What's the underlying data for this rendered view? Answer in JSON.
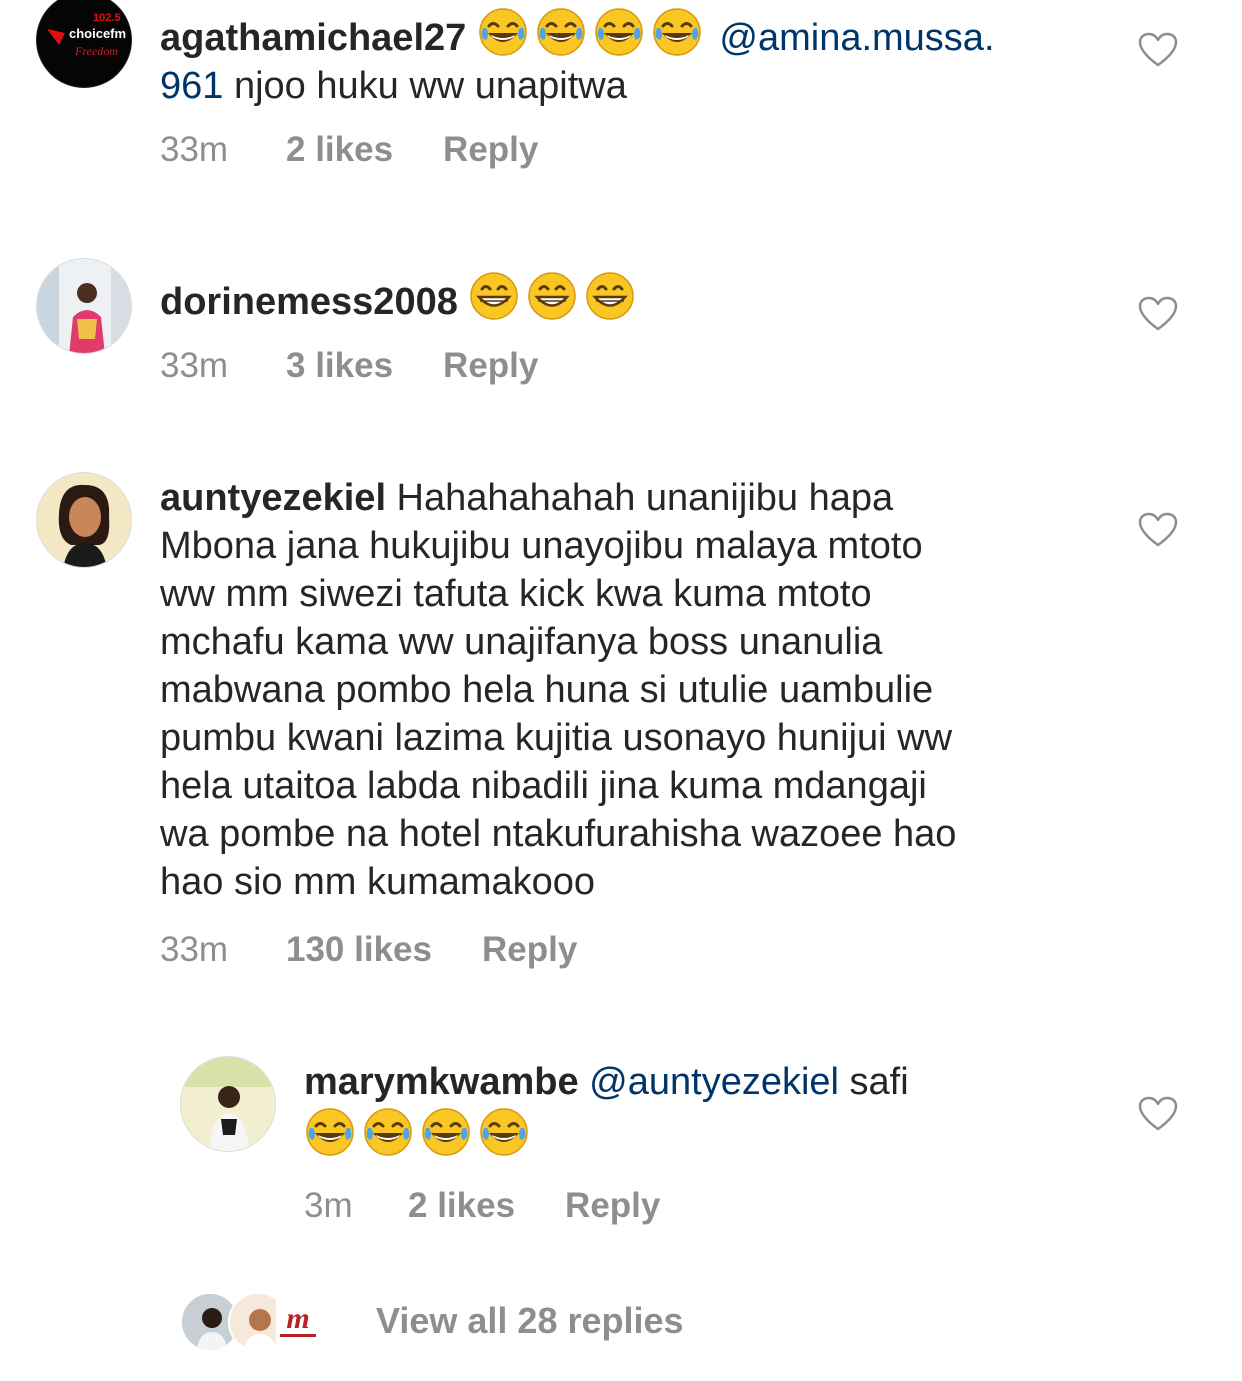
{
  "comments": [
    {
      "username": "agathamichael27",
      "mention": "@amina.mussa.",
      "mention_cont": "961",
      "text": " njoo huku ww unapitwa",
      "time": "33m",
      "likes": "2 likes",
      "reply": "Reply",
      "avatar_badge": "102.5",
      "avatar_brand": "choicefm",
      "avatar_slogan": "Freedom"
    },
    {
      "username": "dorinemess2008",
      "text": "",
      "time": "33m",
      "likes": "3 likes",
      "reply": "Reply"
    },
    {
      "username": "auntyezekiel",
      "text": " Hahahahahah unanijibu hapa",
      "lines": [
        "Mbona jana hukujibu unayojibu malaya mtoto",
        "ww mm siwezi tafuta kick kwa kuma mtoto",
        "mchafu kama ww unajifanya boss unanulia",
        "mabwana pombo hela huna si utulie uambulie",
        "pumbu kwani lazima kujitia usonayo hunijui ww",
        "hela utaitoa labda nibadili jina kuma mdangaji",
        "wa pombe na hotel ntakufurahisha wazoee hao",
        "hao sio mm kumamakooo"
      ],
      "time": "33m",
      "likes": "130 likes",
      "reply": "Reply"
    },
    {
      "username": "marymkwambe",
      "mention": "@auntyezekiel",
      "text": " safi",
      "time": "3m",
      "likes": "2 likes",
      "reply": "Reply"
    }
  ],
  "view_replies": "View all 28 replies",
  "icons": {
    "heart": "heart-outline-icon",
    "laugh": "face-with-tears-of-joy-icon",
    "grin": "grinning-face-icon"
  },
  "colors": {
    "text": "#262626",
    "meta": "#8e8e8e",
    "mention": "#003569"
  }
}
